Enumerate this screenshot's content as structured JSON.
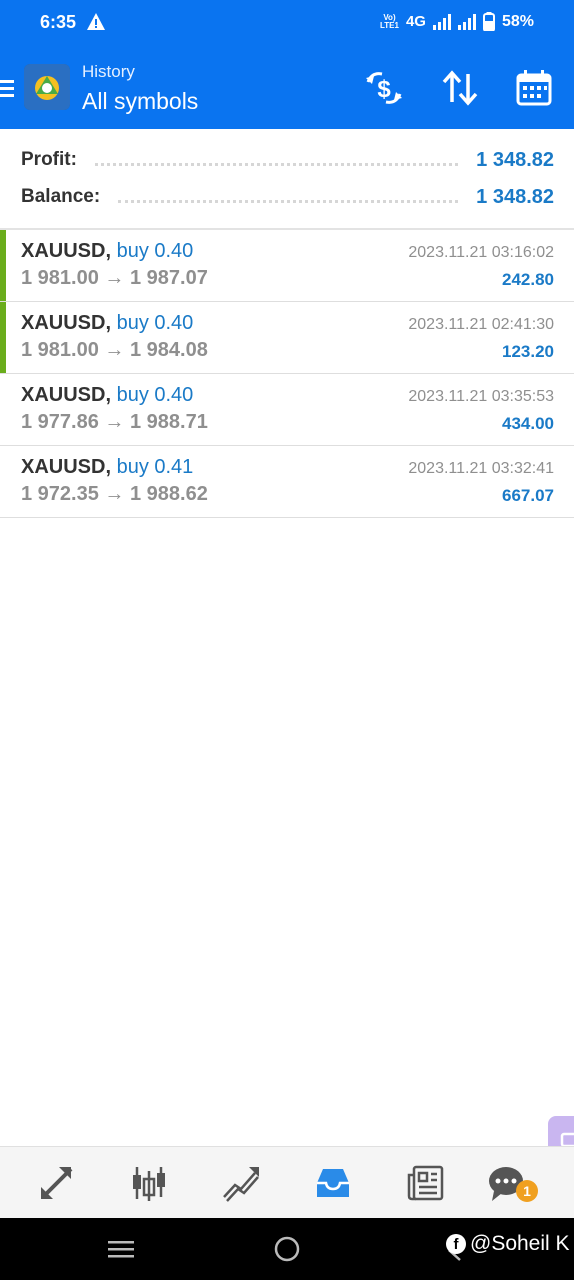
{
  "status_bar": {
    "time": "6:35",
    "network": "4G",
    "battery": "58%"
  },
  "app_bar": {
    "subtitle": "History",
    "title": "All symbols"
  },
  "summary": {
    "profit_label": "Profit:",
    "profit_value": "1 348.82",
    "balance_label": "Balance:",
    "balance_value": "1 348.82"
  },
  "deals": [
    {
      "symbol": "XAUUSD,",
      "type": "buy 0.40",
      "open": "1 981.00",
      "close": "1 987.07",
      "arrow": "→",
      "time": "2023.11.21 03:16:02",
      "profit": "242.80",
      "marker": true
    },
    {
      "symbol": "XAUUSD,",
      "type": "buy 0.40",
      "open": "1 981.00",
      "close": "1 984.08",
      "arrow": "→",
      "time": "2023.11.21 02:41:30",
      "profit": "123.20",
      "marker": true
    },
    {
      "symbol": "XAUUSD,",
      "type": "buy 0.40",
      "open": "1 977.86",
      "close": "1 988.71",
      "arrow": "→",
      "time": "2023.11.21 03:35:53",
      "profit": "434.00",
      "marker": false
    },
    {
      "symbol": "XAUUSD,",
      "type": "buy 0.41",
      "open": "1 972.35",
      "close": "1 988.62",
      "arrow": "→",
      "time": "2023.11.21 03:32:41",
      "profit": "667.07",
      "marker": false
    }
  ],
  "bottom_nav": {
    "items": [
      "quotes-icon",
      "chart-icon",
      "trade-icon",
      "history-icon",
      "news-icon",
      "chat-icon"
    ],
    "active": "history-icon",
    "chat_badge": "1"
  },
  "watermark": "@Soheil K",
  "colors": {
    "app_bar": "#0a74f0",
    "accent": "#1a7ac7",
    "marker": "#6aad1c",
    "badge": "#f0a020"
  }
}
